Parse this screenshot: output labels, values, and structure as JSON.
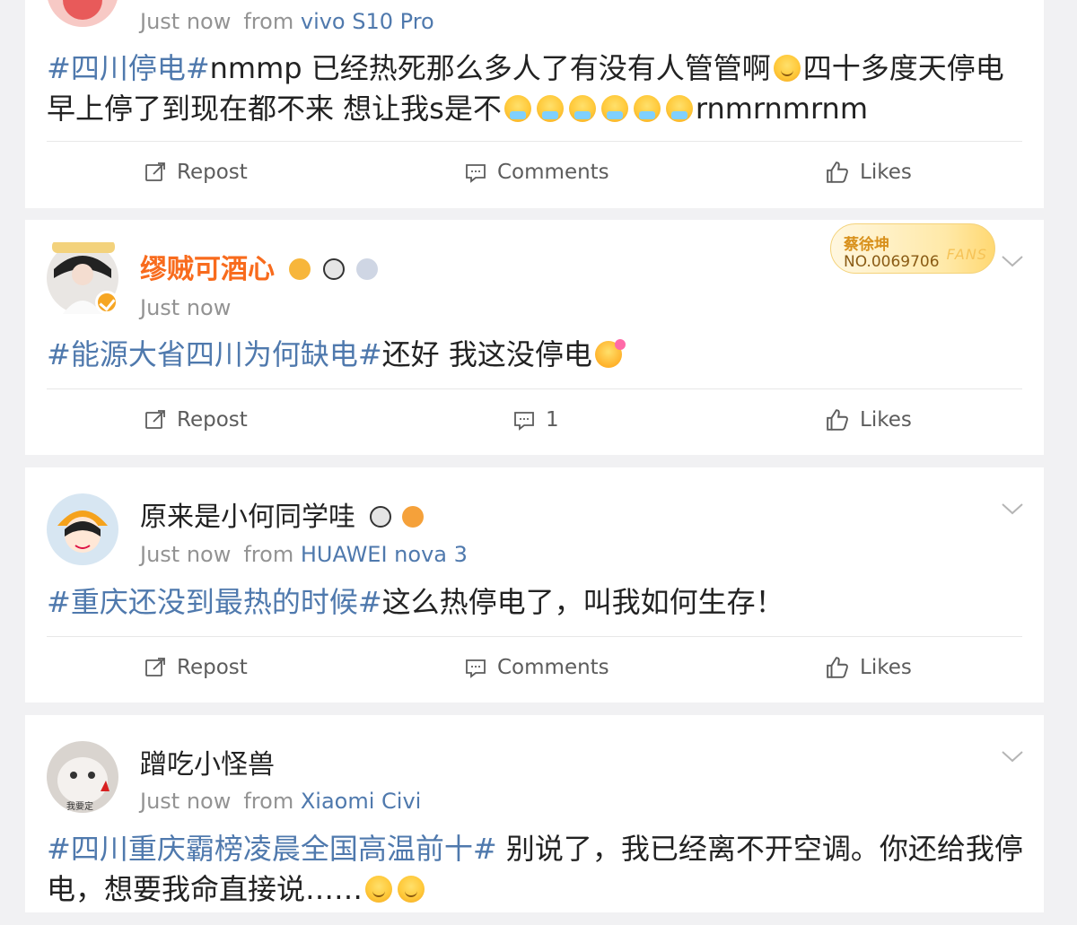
{
  "colors": {
    "link": "#4f79ad",
    "vip_name": "#f86b1d",
    "meta": "#939393",
    "background": "#f1f1f3"
  },
  "posts": [
    {
      "time": "Just now",
      "from_label": "from",
      "device": "vivo S10 Pro",
      "tag": "#四川停电#",
      "text_1": "nmmp 已经热死那么多人了有没有人管管啊",
      "text_2": "四十多度天停电早上停了到现在都不来 想让我s是不",
      "text_3": "rnmrnmrnm",
      "actions": {
        "repost": "Repost",
        "comments": "Comments",
        "likes": "Likes"
      }
    },
    {
      "user": "缪贼可酒心",
      "time": "Just now",
      "fans_badge": {
        "name": "蔡徐坤",
        "number": "NO.0069706",
        "label": "FANS"
      },
      "tag": "#能源大省四川为何缺电#",
      "text": "还好 我这没停电",
      "actions": {
        "repost": "Repost",
        "comments": "1",
        "likes": "Likes"
      }
    },
    {
      "user": "原来是小何同学哇",
      "time": "Just now",
      "from_label": "from",
      "device": "HUAWEI nova 3",
      "tag": "#重庆还没到最热的时候#",
      "text": "这么热停电了，叫我如何生存！",
      "actions": {
        "repost": "Repost",
        "comments": "Comments",
        "likes": "Likes"
      }
    },
    {
      "user": "蹭吃小怪兽",
      "time": "Just now",
      "from_label": "from",
      "device": "Xiaomi Civi",
      "avatar_caption": "我要定",
      "tag": "#四川重庆霸榜凌晨全国高温前十#",
      "text": " 别说了，我已经离不开空调。你还给我停电，想要我命直接说……"
    }
  ],
  "icons": [
    "repost-icon",
    "comment-icon",
    "like-icon",
    "chevron-down-icon",
    "verified-icon"
  ]
}
